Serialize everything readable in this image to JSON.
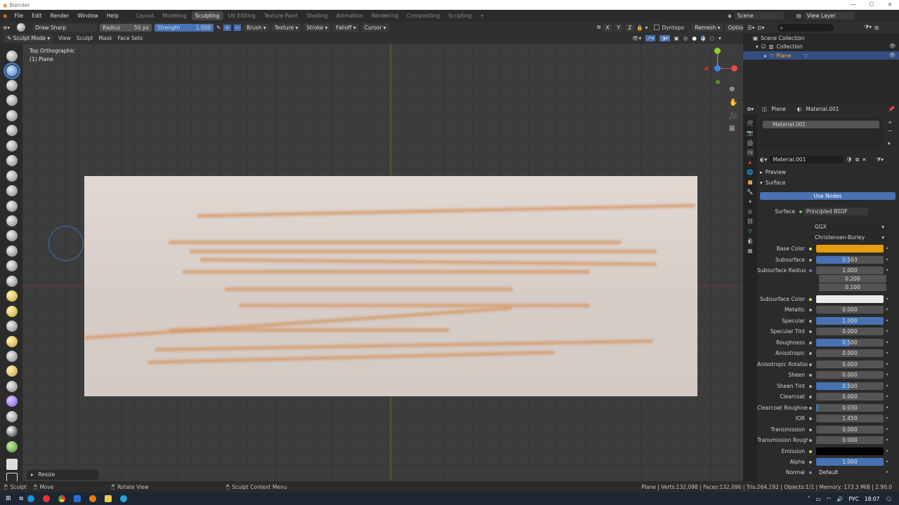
{
  "window": {
    "title": "Blender"
  },
  "menus": [
    "File",
    "Edit",
    "Render",
    "Window",
    "Help"
  ],
  "workspaces": [
    "Layout",
    "Modeling",
    "Sculpting",
    "UV Editing",
    "Texture Paint",
    "Shading",
    "Animation",
    "Rendering",
    "Compositing",
    "Scripting"
  ],
  "active_workspace": "Sculpting",
  "scene": "Scene",
  "view_layer": "View Layer",
  "tool_header": {
    "brush": "Draw Sharp",
    "radius_label": "Radius",
    "radius_value": "50 px",
    "strength_label": "Strength",
    "strength_value": "1.000",
    "strength_fraction": 1.0,
    "menus": [
      "Brush",
      "Texture",
      "Stroke",
      "Falloff",
      "Cursor"
    ],
    "axes": [
      "X",
      "Y",
      "Z"
    ],
    "dyntopo": "Dyntopo",
    "remesh": "Remesh",
    "options": "Options"
  },
  "mode_header": {
    "mode": "Sculpt Mode",
    "items": [
      "View",
      "Sculpt",
      "Mask",
      "Face Sets"
    ]
  },
  "viewport": {
    "view_name": "Top Orthographic",
    "object_name": "(1) Plane",
    "resize_panel": "Resize"
  },
  "outliner": {
    "search_placeholder": "",
    "items": [
      "Scene Collection",
      "Collection",
      "Plane"
    ]
  },
  "properties": {
    "object": "Plane",
    "material": "Material.001",
    "slot": "Material.001",
    "datablock": "Material.001",
    "sections": [
      "Preview",
      "Surface"
    ],
    "use_nodes": "Use Nodes",
    "surface_label": "Surface",
    "surface_value": "Principled BSDF",
    "distribution": "GGX",
    "subsurface_method": "Christensen-Burley",
    "base_color": "#e69c0b",
    "subsurface_radius": [
      "1.000",
      "0.200",
      "0.100"
    ],
    "rows": [
      {
        "label": "Base Color",
        "dot": "y",
        "type": "color",
        "color": "#e69c0b"
      },
      {
        "label": "Subsurface",
        "dot": "g",
        "value": "0.503",
        "fraction": 0.503
      },
      {
        "label": "Subsurface Radius",
        "dot": "p",
        "value": "1.000",
        "fraction": 0
      },
      {
        "label": "Subsurface Color",
        "dot": "y",
        "type": "color",
        "color": "#ebebeb"
      },
      {
        "label": "Metallic",
        "dot": "g",
        "value": "0.000",
        "fraction": 0
      },
      {
        "label": "Specular",
        "dot": "g",
        "value": "1.000",
        "fraction": 1
      },
      {
        "label": "Specular Tint",
        "dot": "g",
        "value": "0.000",
        "fraction": 0
      },
      {
        "label": "Roughness",
        "dot": "g",
        "value": "0.500",
        "fraction": 0.5
      },
      {
        "label": "Anisotropic",
        "dot": "g",
        "value": "0.000",
        "fraction": 0
      },
      {
        "label": "Anisotropic Rotation",
        "dot": "g",
        "value": "0.000",
        "fraction": 0
      },
      {
        "label": "Sheen",
        "dot": "g",
        "value": "0.000",
        "fraction": 0
      },
      {
        "label": "Sheen Tint",
        "dot": "g",
        "value": "0.500",
        "fraction": 0.5
      },
      {
        "label": "Clearcoat",
        "dot": "g",
        "value": "0.000",
        "fraction": 0
      },
      {
        "label": "Clearcoat Roughness",
        "dot": "g",
        "value": "0.030",
        "fraction": 0.03
      },
      {
        "label": "IOR",
        "dot": "g",
        "value": "1.450",
        "fraction": 0
      },
      {
        "label": "Transmission",
        "dot": "g",
        "value": "0.000",
        "fraction": 0
      },
      {
        "label": "Transmission Roughness",
        "dot": "g",
        "value": "0.000",
        "fraction": 0
      },
      {
        "label": "Emission",
        "dot": "y",
        "type": "color",
        "color": "#000000"
      },
      {
        "label": "Alpha",
        "dot": "g",
        "value": "1.000",
        "fraction": 1
      },
      {
        "label": "Normal",
        "dot": "p",
        "type": "text",
        "value": "Default"
      }
    ]
  },
  "status": {
    "left": [
      {
        "key": "Sculpt"
      },
      {
        "key": "Move"
      },
      {
        "key": "Rotate View"
      },
      {
        "key": "Sculpt Context Menu"
      }
    ],
    "right": "Plane | Verts:132,098 | Faces:132,096 | Tris:264,192 | Objects:1/1 | Memory: 173.3 MiB | 2.90.0"
  },
  "taskbar": {
    "lang": "РУС",
    "time": "18:07"
  }
}
